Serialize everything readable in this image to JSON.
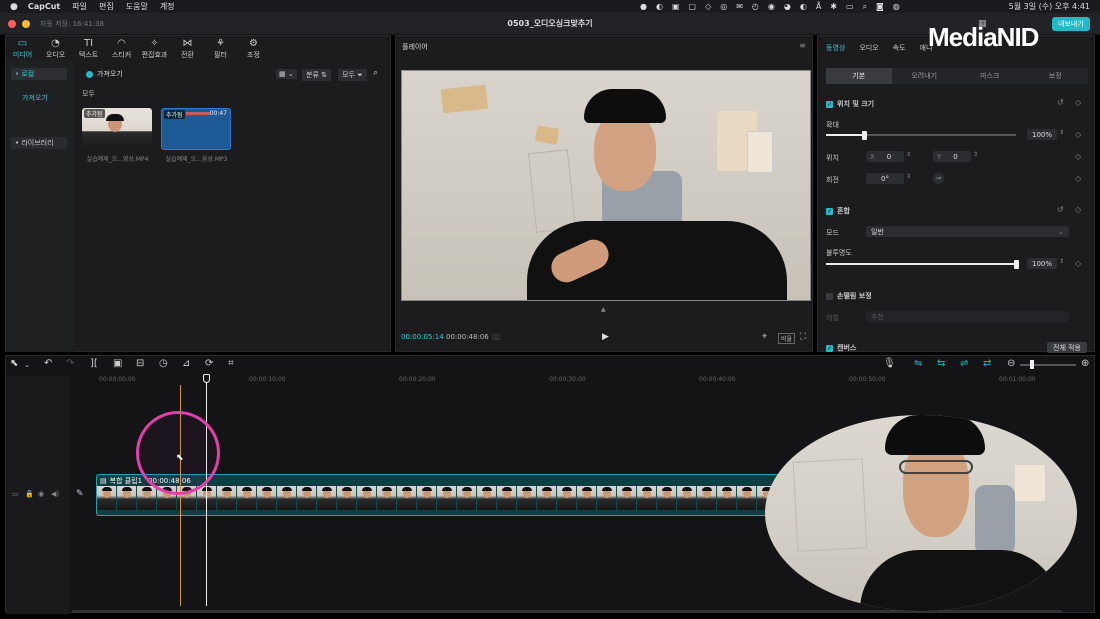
{
  "menubar": {
    "app_name": "CapCut",
    "items": [
      "파일",
      "편집",
      "도움말",
      "계정"
    ],
    "clock": "5월 3일 (수) 오후 4:41"
  },
  "titlebar": {
    "autosave": "자동 저장: 16:41:38",
    "project_title": "0503_오디오싱크맞추기",
    "export_label": "내보내기"
  },
  "watermark": {
    "text": "MediaNID"
  },
  "media_tools": [
    {
      "label": "미디어",
      "icon": "media-icon",
      "glyph": "▭"
    },
    {
      "label": "오디오",
      "icon": "audio-icon",
      "glyph": "◔"
    },
    {
      "label": "텍스트",
      "icon": "text-icon",
      "glyph": "TI"
    },
    {
      "label": "스티커",
      "icon": "sticker-icon",
      "glyph": "◠"
    },
    {
      "label": "편집효과",
      "icon": "effects-icon",
      "glyph": "✧"
    },
    {
      "label": "전환",
      "icon": "transition-icon",
      "glyph": "⋈"
    },
    {
      "label": "필터",
      "icon": "filter-icon",
      "glyph": "⚘"
    },
    {
      "label": "조정",
      "icon": "adjust-icon",
      "glyph": "⚙"
    }
  ],
  "media_sidebar": {
    "local": "• 로컬",
    "import": "가져오기",
    "library": "• 라이브러리"
  },
  "media_header": {
    "import_button": "가져오기",
    "sort_label": "분류",
    "filter_label": "모두",
    "section_label": "모두"
  },
  "media_items": [
    {
      "tag": "추가됨",
      "duration": "",
      "name": "실습예제_오...영상.MP4"
    },
    {
      "tag": "추가됨",
      "duration": "00:47",
      "name": "실습예제_오...음성.MP3"
    }
  ],
  "player": {
    "title": "플레이어",
    "current_time": "00:00:05:14",
    "total_time": "00:00:48:06",
    "ratio_label": "비율"
  },
  "inspector": {
    "tabs": [
      "동영상",
      "오디오",
      "속도",
      "애니"
    ],
    "subtabs": [
      "기본",
      "오려내기",
      "마스크",
      "보정"
    ],
    "position_size": {
      "title": "위치 및 크기",
      "scale_label": "확대",
      "scale_value": "100%",
      "scale_fraction": 0.2,
      "position_label": "위치",
      "x_label": "X",
      "x_value": "0",
      "y_label": "Y",
      "y_value": "0",
      "rotation_label": "회전",
      "rotation_value": "0°"
    },
    "blend": {
      "title": "혼합",
      "mode_label": "모드",
      "mode_value": "일반",
      "opacity_label": "불투명도",
      "opacity_value": "100%",
      "opacity_fraction": 1.0
    },
    "stabilize": {
      "title": "손떨림 보정",
      "level_label": "레벨",
      "level_value": "추천"
    },
    "canvas": {
      "title": "캔버스",
      "apply_all": "전체 적용"
    }
  },
  "timeline": {
    "ticks": [
      "00:00:00:00",
      "00:00:10:00",
      "00:00:20:00",
      "00:00:30:00",
      "00:00:40:00",
      "00:00:50:00",
      "00:01:00:00"
    ],
    "clip_label": "복합 클립1",
    "clip_duration": "00:00:48:06"
  },
  "colors": {
    "accent": "#25b8c7",
    "clip_border": "#1fa3b0",
    "cursor_ring": "#e040a8",
    "playhead_marker": "#d09a3a"
  }
}
